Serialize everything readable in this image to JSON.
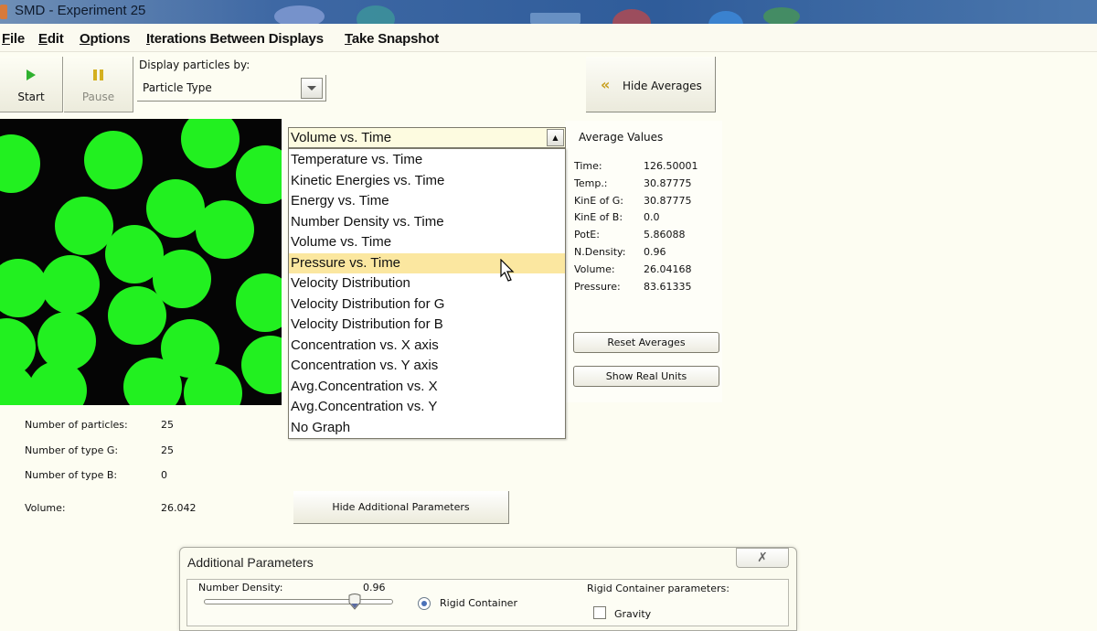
{
  "window": {
    "title": "SMD - Experiment 25"
  },
  "menu": [
    {
      "label": "File",
      "mnemonic": "F"
    },
    {
      "label": "Edit",
      "mnemonic": "E"
    },
    {
      "label": "Options",
      "mnemonic": "O"
    },
    {
      "label": "Iterations Between Displays",
      "mnemonic": "I"
    },
    {
      "label": "Take Snapshot",
      "mnemonic": "T"
    }
  ],
  "toolbar": {
    "start_label": "Start",
    "pause_label": "Pause",
    "display_by_label": "Display particles by:",
    "display_by_value": "Particle Type",
    "hide_averages_label": "Hide Averages"
  },
  "colors": {
    "particle_G": "#22f020",
    "canvas_bg": "#050505",
    "selected_option": "#fbe7a0",
    "start_icon": "#2fb12f",
    "pause_icon": "#d4b020"
  },
  "graph_select": {
    "value": "Volume vs. Time",
    "options": [
      "Temperature vs. Time",
      "Kinetic Energies vs. Time",
      "Energy vs. Time",
      "Number Density vs. Time",
      "Volume vs. Time",
      "Pressure vs. Time",
      "Velocity Distribution",
      "Velocity Distribution for G",
      "Velocity Distribution for B",
      "Concentration vs. X axis",
      "Concentration vs. Y axis",
      "Avg.Concentration vs. X",
      "Avg.Concentration vs. Y",
      "No Graph"
    ],
    "highlighted": "Pressure vs. Time"
  },
  "averages": {
    "title": "Average Values",
    "rows": [
      {
        "label": "Time:",
        "value": "126.50001"
      },
      {
        "label": "Temp.:",
        "value": "30.87775"
      },
      {
        "label": "KinE of G:",
        "value": "30.87775"
      },
      {
        "label": "KinE of B:",
        "value": "0.0"
      },
      {
        "label": "PotE:",
        "value": "5.86088"
      },
      {
        "label": "N.Density:",
        "value": "0.96"
      },
      {
        "label": "Volume:",
        "value": "26.04168"
      },
      {
        "label": "Pressure:",
        "value": "83.61335"
      }
    ],
    "reset_label": "Reset Averages",
    "real_units_label": "Show Real Units"
  },
  "stats": [
    {
      "label": "Number of particles:",
      "value": "25"
    },
    {
      "label": "Number of type G:",
      "value": "25"
    },
    {
      "label": "Number of type B:",
      "value": "0"
    },
    {
      "label": "Volume:",
      "value": "26.042"
    }
  ],
  "hide_additional_label": "Hide Additional Parameters",
  "additional": {
    "title": "Additional Parameters",
    "number_density_label": "Number Density:",
    "number_density_value": "0.96",
    "number_density_slider_fraction": 0.8,
    "rigid_container_label": "Rigid Container",
    "rigid_container_selected": true,
    "rigid_params_label": "Rigid Container parameters:",
    "gravity_label": "Gravity",
    "gravity_checked": false
  }
}
